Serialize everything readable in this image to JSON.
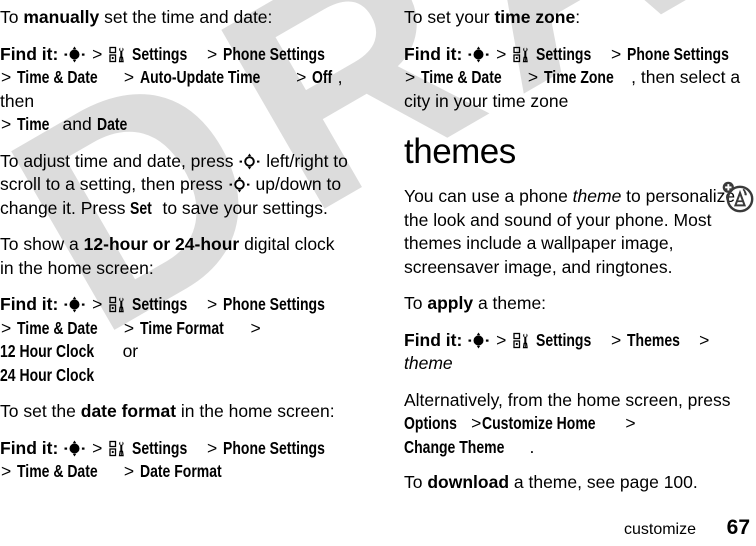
{
  "document": {
    "watermark": "DRAFT",
    "footer": {
      "chapter": "customize",
      "page_number": "67"
    },
    "margin_icon": "antenna-network-icon"
  },
  "icons": {
    "navkey_filled": "navigation-key-icon",
    "navkey_hollow": "navigation-key-hollow-icon",
    "settings_gear": "settings-tools-icon"
  },
  "left_column": {
    "p1": {
      "pre": "To ",
      "bold": "manually",
      "post": " set the time and date:"
    },
    "findit1": {
      "label": "Find it:",
      "path": [
        "Settings",
        "Phone Settings",
        "Time & Date",
        "Auto-Update Time",
        "Off"
      ],
      "tail_then": ", then",
      "tail_path": [
        "Time",
        "Date"
      ],
      "tail_and": "and"
    },
    "p2": {
      "s1": "To adjust time and date, press ",
      "s2": " left/right to scroll to a setting, then press ",
      "s3": " up/down to change it. Press ",
      "bold_set": "Set",
      "s4": " to save your settings."
    },
    "p3": {
      "pre": "To show a ",
      "bold": "12-hour or 24-hour",
      "post": " digital clock in the home screen:"
    },
    "findit2": {
      "label": "Find it:",
      "path": [
        "Settings",
        "Phone Settings",
        "Time & Date",
        "Time Format",
        "12 Hour Clock"
      ],
      "or_word": "or",
      "alt": "24 Hour Clock"
    },
    "p4": {
      "pre": "To set the ",
      "bold": "date format",
      "post": " in the home screen:"
    },
    "findit3": {
      "label": "Find it:",
      "path": [
        "Settings",
        "Phone Settings",
        "Time & Date",
        "Date Format"
      ]
    }
  },
  "right_column": {
    "p1": {
      "pre": "To set your ",
      "bold": "time zone",
      "post": ":"
    },
    "findit1": {
      "label": "Find it:",
      "path": [
        "Settings",
        "Phone Settings",
        "Time & Date",
        "Time Zone"
      ],
      "tail": ", then select a city in your time zone"
    },
    "heading": "themes",
    "p2": {
      "s1": "You can use a phone ",
      "ital": "theme",
      "s2": " to personalize the look and sound of your phone. Most themes include a wallpaper image, screensaver image, and ringtones."
    },
    "p3": {
      "pre": "To ",
      "bold": "apply",
      "post": " a theme:"
    },
    "findit2": {
      "label": "Find it:",
      "path": [
        "Settings",
        "Themes"
      ],
      "ital_tail": "theme"
    },
    "p4": {
      "s1": "Alternatively, from the home screen, press ",
      "path": [
        "Options",
        "Customize Home",
        "Change Theme"
      ],
      "period": "."
    },
    "p5": {
      "pre": "To ",
      "bold": "download",
      "post": " a theme, see page 100."
    }
  }
}
